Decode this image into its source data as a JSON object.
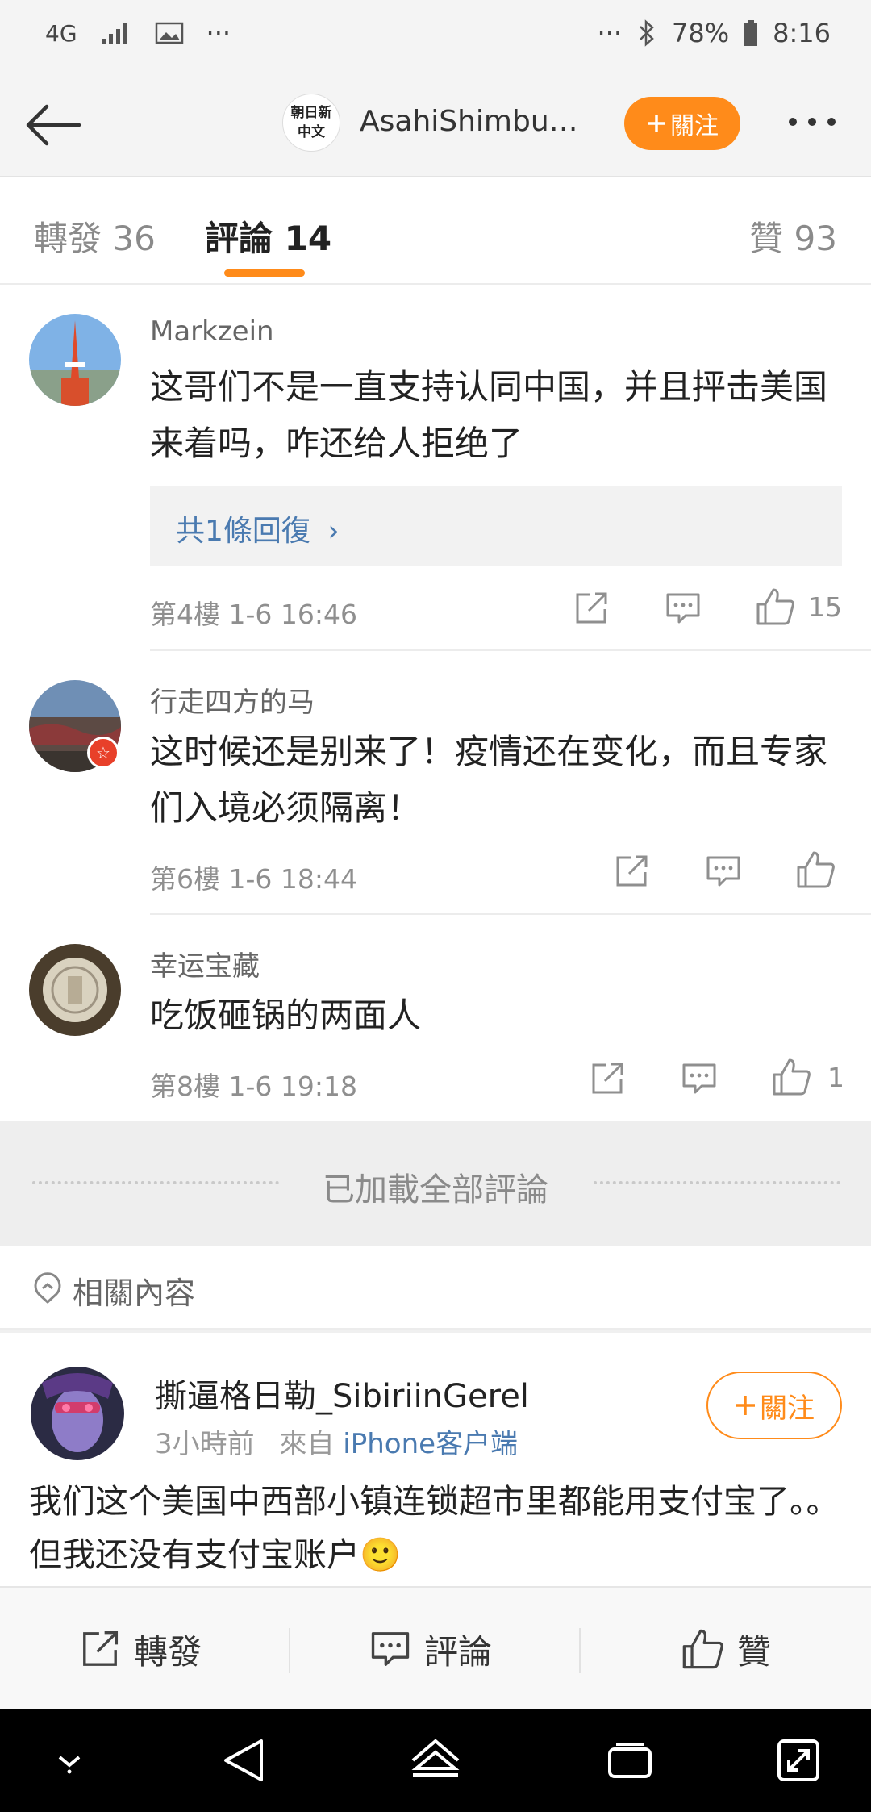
{
  "status_bar": {
    "network": "4G",
    "more": "···",
    "more_right": "···",
    "battery": "78%",
    "time": "8:16"
  },
  "header": {
    "account_logo_line1": "朝日新",
    "account_logo_line2": "中文",
    "account_name": "AsahiShimbun...",
    "follow_label": "關注"
  },
  "tabs": [
    {
      "label": "轉發 36"
    },
    {
      "label": "評論 14"
    },
    {
      "label": "贊 93"
    }
  ],
  "comments": [
    {
      "username": "Markzein",
      "text": "这哥们不是一直支持认同中国，并且抨击美国来着吗，咋还给人拒绝了",
      "replies_label": "共1條回復",
      "floor": "第4樓",
      "time": "1-6 16:46",
      "likes": "15"
    },
    {
      "username": "行走四方的马",
      "text": "这时候还是别来了！疫情还在变化，而且专家们入境必须隔离！",
      "floor": "第6樓",
      "time": "1-6 18:44",
      "likes": ""
    },
    {
      "username": "幸运宝藏",
      "text": "吃饭砸锅的两面人",
      "floor": "第8樓",
      "time": "1-6 19:18",
      "likes": "1"
    }
  ],
  "all_loaded_label": "已加載全部評論",
  "related": {
    "label": "相關內容"
  },
  "related_post": {
    "username": "撕逼格日勒_SibiriinGerel",
    "time": "3小時前",
    "from_prefix": "來自",
    "source": "iPhone客户端",
    "follow_label": "關注",
    "text": "我们这个美国中西部小镇连锁超市里都能用支付宝了。。但我还没有支付宝账户",
    "emoji": "🙂"
  },
  "bottom_bar": {
    "repost": "轉發",
    "comment": "評論",
    "like": "贊"
  },
  "colors": {
    "accent": "#ff8b1a",
    "link": "#4a7ab0",
    "background": "#f4f4f4"
  }
}
